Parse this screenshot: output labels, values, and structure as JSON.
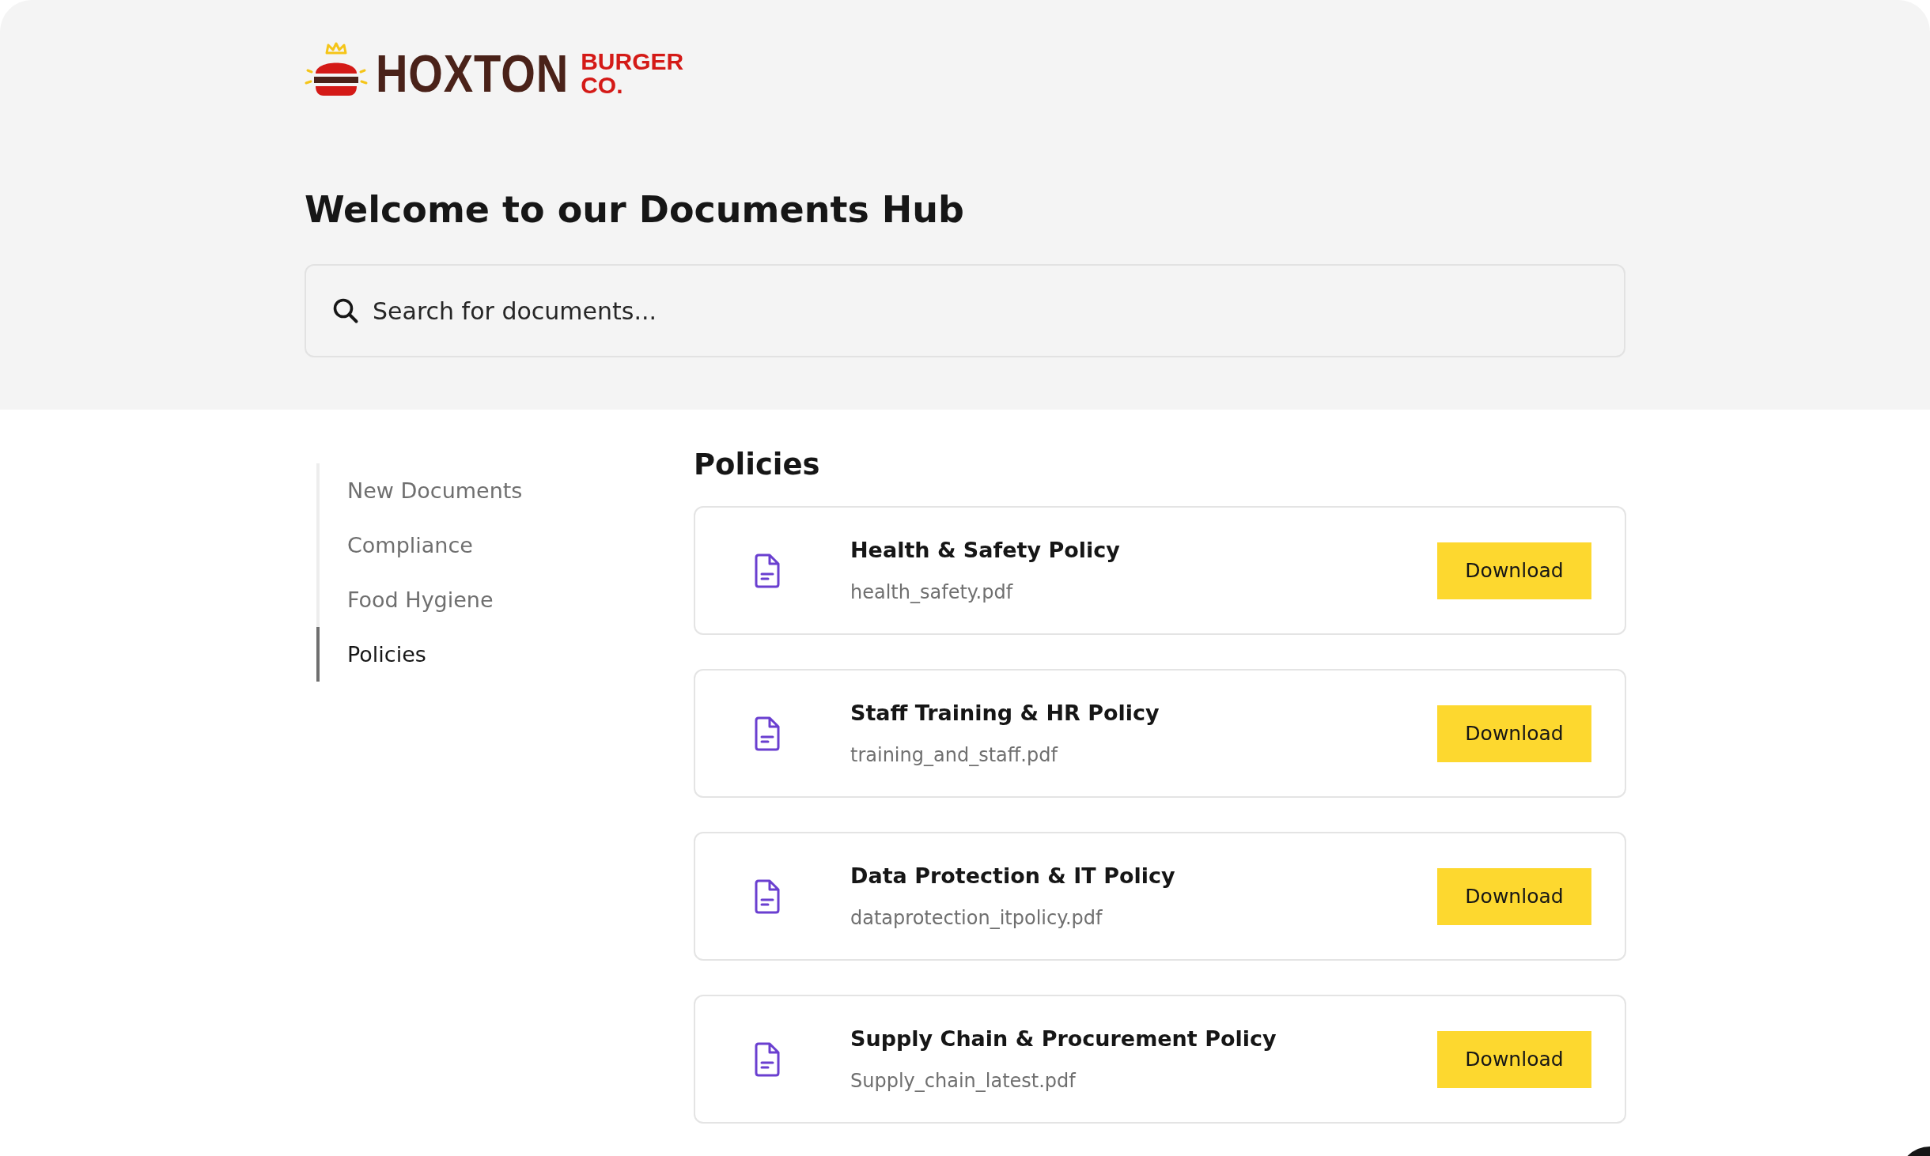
{
  "logo": {
    "name": "HOXTON",
    "sub_1": "BURGER",
    "sub_2": "CO."
  },
  "heading": "Welcome to our Documents Hub",
  "search": {
    "placeholder": "Search for documents..."
  },
  "sidebar": {
    "items": [
      {
        "label": "New Documents",
        "selected": false
      },
      {
        "label": "Compliance",
        "selected": false
      },
      {
        "label": "Food Hygiene",
        "selected": false
      },
      {
        "label": "Policies",
        "selected": true
      }
    ]
  },
  "section_title": "Policies",
  "documents": [
    {
      "title": "Health & Safety Policy",
      "file": "health_safety.pdf",
      "button": "Download"
    },
    {
      "title": "Staff Training & HR Policy",
      "file": "training_and_staff.pdf",
      "button": "Download"
    },
    {
      "title": "Data Protection & IT Policy",
      "file": "dataprotection_itpolicy.pdf",
      "button": "Download"
    },
    {
      "title": "Supply Chain & Procurement Policy",
      "file": "Supply_chain_latest.pdf",
      "button": "Download"
    }
  ]
}
